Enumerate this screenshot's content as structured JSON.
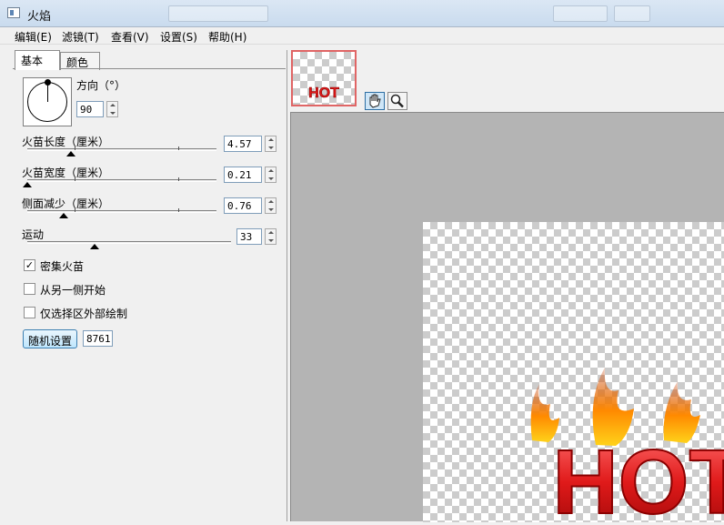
{
  "window": {
    "title": "火焰"
  },
  "menu": [
    "编辑(E)",
    "滤镜(T)",
    "查看(V)",
    "设置(S)",
    "帮助(H)"
  ],
  "tabs": [
    "基本",
    "颜色"
  ],
  "direction": {
    "label": "方向（°）",
    "value": "90"
  },
  "sliders": [
    {
      "label": "火苗长度（厘米）",
      "value": "4.57",
      "position_pct": 23
    },
    {
      "label": "火苗宽度（厘米）",
      "value": "0.21",
      "position_pct": 0
    },
    {
      "label": "侧面减少（厘米）",
      "value": "0.76",
      "position_pct": 19
    },
    {
      "label": "运动",
      "value": "33",
      "position_pct": 33
    }
  ],
  "checkboxes": [
    {
      "label": "密集火苗",
      "checked": true,
      "mark": "✓"
    },
    {
      "label": "从另一侧开始",
      "checked": false,
      "mark": ""
    },
    {
      "label": "仅选择区外部绘制",
      "checked": false,
      "mark": ""
    }
  ],
  "random": {
    "button_label": "随机设置",
    "seed": "8761"
  },
  "preview": {
    "thumbnail_text": "HOT",
    "image_text": "HOT"
  },
  "tools": [
    "hand-icon",
    "zoom-icon"
  ],
  "colors": {
    "text_red": "#e01a1a",
    "canvas_bg": "#b4b4b4"
  }
}
